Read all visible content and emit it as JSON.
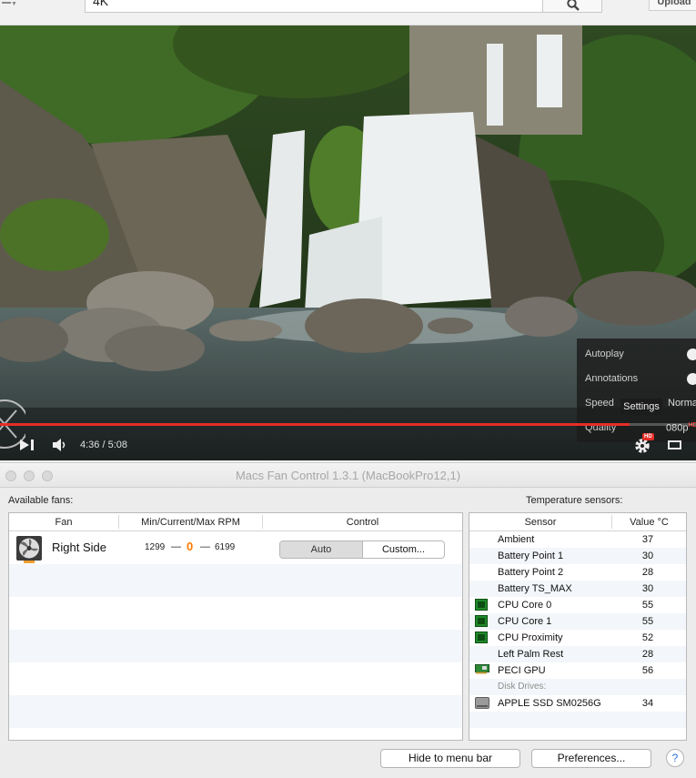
{
  "browser": {
    "search_value": "4K",
    "upload_label": "Upload"
  },
  "player": {
    "settings_menu": {
      "autoplay_label": "Autoplay",
      "annotations_label": "Annotations",
      "speed_label": "Speed",
      "speed_value": "Norma",
      "quality_label": "Quality",
      "quality_value": "080p",
      "quality_badge": "HD"
    },
    "settings_tooltip": "Settings",
    "time": "4:36 / 5:08",
    "progress_fraction": 0.905,
    "hd_badge": "HD"
  },
  "app": {
    "window_title": "Macs Fan Control 1.3.1 (MacBookPro12,1)",
    "available_fans_label": "Available fans:",
    "temperature_sensors_label": "Temperature sensors:",
    "fans_columns": [
      "Fan",
      "Min/Current/Max RPM",
      "Control"
    ],
    "fans": [
      {
        "name": "Right Side",
        "min": "1299",
        "current": "0",
        "max": "6199",
        "sep": "—",
        "control_auto": "Auto",
        "control_custom": "Custom..."
      }
    ],
    "sensor_columns": [
      "Sensor",
      "Value °C"
    ],
    "sensors": [
      {
        "name": "Ambient",
        "value": "37",
        "icon": "none"
      },
      {
        "name": "Battery Point 1",
        "value": "30",
        "icon": "none"
      },
      {
        "name": "Battery Point 2",
        "value": "28",
        "icon": "none"
      },
      {
        "name": "Battery TS_MAX",
        "value": "30",
        "icon": "none"
      },
      {
        "name": "CPU Core 0",
        "value": "55",
        "icon": "cpu-chip-icon"
      },
      {
        "name": "CPU Core 1",
        "value": "55",
        "icon": "cpu-chip-icon"
      },
      {
        "name": "CPU Proximity",
        "value": "52",
        "icon": "cpu-chip-icon"
      },
      {
        "name": "Left Palm Rest",
        "value": "28",
        "icon": "none"
      },
      {
        "name": "PECI GPU",
        "value": "56",
        "icon": "gpu-card-icon"
      }
    ],
    "disk_group_label": "Disk Drives:",
    "disks": [
      {
        "name": "APPLE SSD SM0256G",
        "value": "34",
        "icon": "hard-drive-icon"
      }
    ],
    "hide_button": "Hide to menu bar",
    "preferences_button": "Preferences...",
    "help_button": "?"
  },
  "colors": {
    "accent_orange": "#ff7a00",
    "progress_red": "#e52d27",
    "help_blue": "#2a6bd6"
  }
}
